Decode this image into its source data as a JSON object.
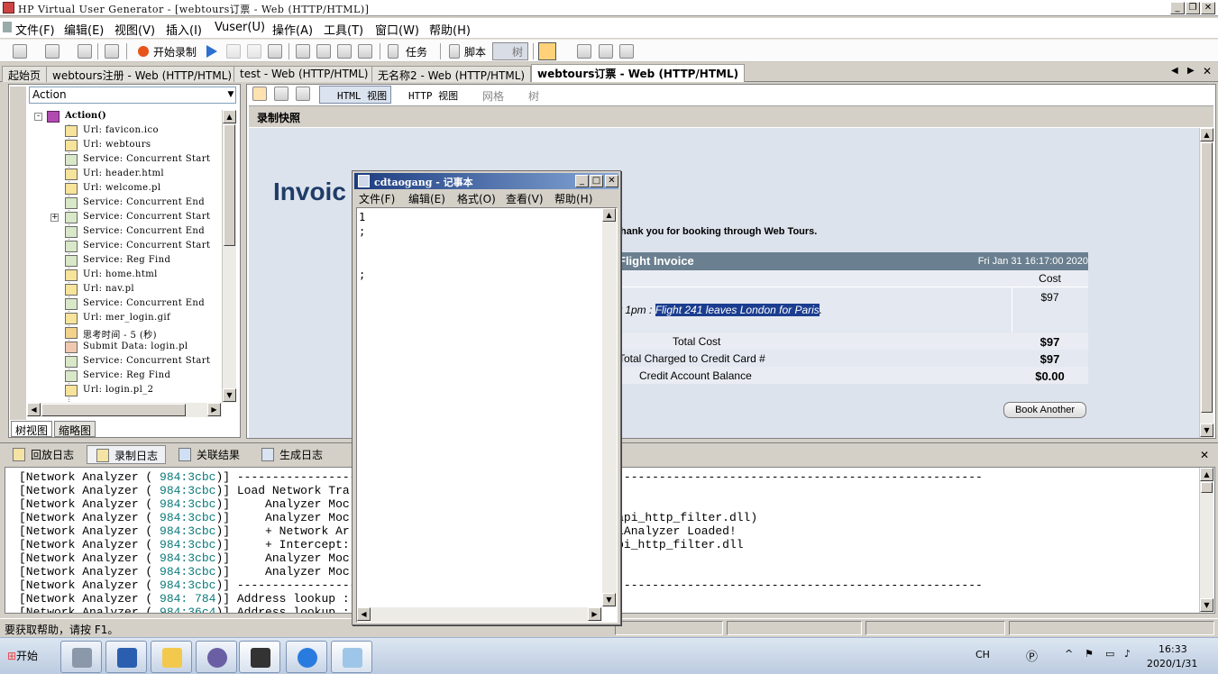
{
  "window": {
    "title": "HP Virtual User Generator - [webtours订票 - Web (HTTP/HTML)]"
  },
  "menu": [
    "文件(F)",
    "编辑(E)",
    "视图(V)",
    "插入(I)",
    "Vuser(U)",
    "操作(A)",
    "工具(T)",
    "窗口(W)",
    "帮助(H)"
  ],
  "toolbar": {
    "start_record": "开始录制",
    "tasks": "任务",
    "script": "脚本",
    "tree": "树"
  },
  "doc_tabs": [
    {
      "label": "起始页",
      "active": false
    },
    {
      "label": "webtours注册 - Web (HTTP/HTML)",
      "active": false
    },
    {
      "label": "test - Web (HTTP/HTML)",
      "active": false
    },
    {
      "label": "无名称2 - Web (HTTP/HTML)",
      "active": false
    },
    {
      "label": "webtours订票 - Web (HTTP/HTML)",
      "active": true
    }
  ],
  "left_pane": {
    "combo_value": "Action",
    "tree_root": "Action()",
    "tree_items": [
      {
        "icon": "url",
        "text": "Url: favicon.ico"
      },
      {
        "icon": "url",
        "text": "Url: webtours"
      },
      {
        "icon": "service",
        "text": "Service: Concurrent Start"
      },
      {
        "icon": "url",
        "text": "Url: header.html"
      },
      {
        "icon": "url",
        "text": "Url: welcome.pl"
      },
      {
        "icon": "service",
        "text": "Service: Concurrent End"
      },
      {
        "icon": "service",
        "text": "Service: Concurrent Start"
      },
      {
        "icon": "service",
        "text": "Service: Concurrent End"
      },
      {
        "icon": "service",
        "text": "Service: Concurrent Start"
      },
      {
        "icon": "service",
        "text": "Service: Reg Find"
      },
      {
        "icon": "url",
        "text": "Url: home.html"
      },
      {
        "icon": "url",
        "text": "Url: nav.pl"
      },
      {
        "icon": "service",
        "text": "Service: Concurrent End"
      },
      {
        "icon": "url",
        "text": "Url: mer_login.gif"
      },
      {
        "icon": "think",
        "text": "思考时间 - 5 (秒)"
      },
      {
        "icon": "submit",
        "text": "Submit Data: login.pl"
      },
      {
        "icon": "service",
        "text": "Service: Concurrent Start"
      },
      {
        "icon": "service",
        "text": "Service: Reg Find"
      },
      {
        "icon": "url",
        "text": "Url: login.pl_2"
      }
    ],
    "bottom_tabs": [
      "树视图",
      "缩略图"
    ]
  },
  "view_bar": {
    "html_view": "HTML 视图",
    "http_view": "HTTP 视图",
    "grid": "网格",
    "tree": "树"
  },
  "snapshot": {
    "header": "录制快照",
    "invoice_title": "Invoic",
    "thanks": "hank you for booking through Web Tours.",
    "bar_title": "Flight Invoice",
    "bar_date": "Fri Jan 31 16:17:00 2020",
    "cost_header": "Cost",
    "cost_value": "$97",
    "flight_prefix": "r 1pm : ",
    "flight_text": "Flight 241 leaves London for Paris",
    "flight_suffix": ".",
    "total_cost_label": "Total Cost",
    "total_cost_value": "$97",
    "charged_label": "Total Charged to Credit Card #",
    "charged_value": "$97",
    "balance_label": "Credit Account Balance",
    "balance_value": "$0.00",
    "book_another": "Book Another"
  },
  "log_tabs": [
    "回放日志",
    "录制日志",
    "关联结果",
    "生成日志"
  ],
  "log_lines": [
    {
      "prefix": "[Network Analyzer ( ",
      "num": "984:3cbc",
      "suffix": ")] ----------------------------------------------------------------------------------------------------------"
    },
    {
      "prefix": "[Network Analyzer ( ",
      "num": "984:3cbc",
      "suffix": ")] Load Network Tra"
    },
    {
      "prefix": "[Network Analyzer ( ",
      "num": "984:3cbc",
      "suffix": ")]     Analyzer Moc"
    },
    {
      "prefix": "[Network Analyzer ( ",
      "num": "984:3cbc",
      "suffix": ")]     Analyzer Moc                               alyzer:api_http_filter.dll)"
    },
    {
      "prefix": "[Network Analyzer ( ",
      "num": "984:3cbc",
      "suffix": ")]     + Network Ar                               ProtocolAnalyzer Loaded!"
    },
    {
      "prefix": "[Network Analyzer ( ",
      "num": "984:3cbc",
      "suffix": ")]     + Intercept:                               Audit:api_http_filter.dll"
    },
    {
      "prefix": "[Network Analyzer ( ",
      "num": "984:3cbc",
      "suffix": ")]     Analyzer Moc"
    },
    {
      "prefix": "[Network Analyzer ( ",
      "num": "984:3cbc",
      "suffix": ")]     Analyzer Moc"
    },
    {
      "prefix": "[Network Analyzer ( ",
      "num": "984:3cbc",
      "suffix": ")] ----------------------------------------------------------------------------------------------------------"
    },
    {
      "prefix": "[Network Analyzer ( ",
      "num": "984: 784",
      "suffix": ")] Address lookup :"
    },
    {
      "prefix": "[Network Analyzer ( ",
      "num": "984:36c4",
      "suffix": ")] Address lookup :"
    }
  ],
  "status_bar": {
    "help": "要获取帮助，请按 F1。"
  },
  "taskbar": {
    "start": "开始",
    "lang": "CH",
    "time": "16:33",
    "date": "2020/1/31"
  },
  "notepad": {
    "title": "cdtaogang - 记事本",
    "menu": [
      "文件(F)",
      "编辑(E)",
      "格式(O)",
      "查看(V)",
      "帮助(H)"
    ],
    "lines": [
      "1",
      ";",
      "",
      "",
      ";"
    ]
  },
  "colors": {
    "arrow": "#e8342c",
    "invoice_title": "#1f3c68",
    "invoice_bar": "#6a7f8f",
    "selection": "#1b3d8f"
  }
}
